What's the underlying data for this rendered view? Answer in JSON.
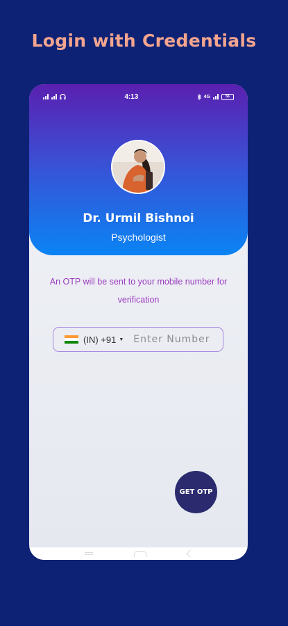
{
  "promo": {
    "title": "Login with Credentials"
  },
  "status_bar": {
    "time": "4:13",
    "left_icons": [
      "signal-icon",
      "signal-icon",
      "headset-icon"
    ],
    "right_icons": [
      "bluetooth-icon",
      "network-icon",
      "signal-icon",
      "battery-icon"
    ],
    "network_label": "4G",
    "battery_level": "56"
  },
  "profile": {
    "name": "Dr. Urmil Bishnoi",
    "role": "Psychologist"
  },
  "login": {
    "otp_message": "An OTP will be sent to your mobile number for verification",
    "country_code": "(IN) +91",
    "phone_placeholder": "Enter Number",
    "phone_value": "",
    "submit_label": "GET OTP"
  },
  "colors": {
    "background": "#0e2275",
    "promo_title": "#f3a58f",
    "header_gradient": [
      "#5a1fb0",
      "#0a84f4"
    ],
    "message_text": "#9b3bbf",
    "input_border": "#a788e0",
    "button": "#2b2a6e"
  }
}
